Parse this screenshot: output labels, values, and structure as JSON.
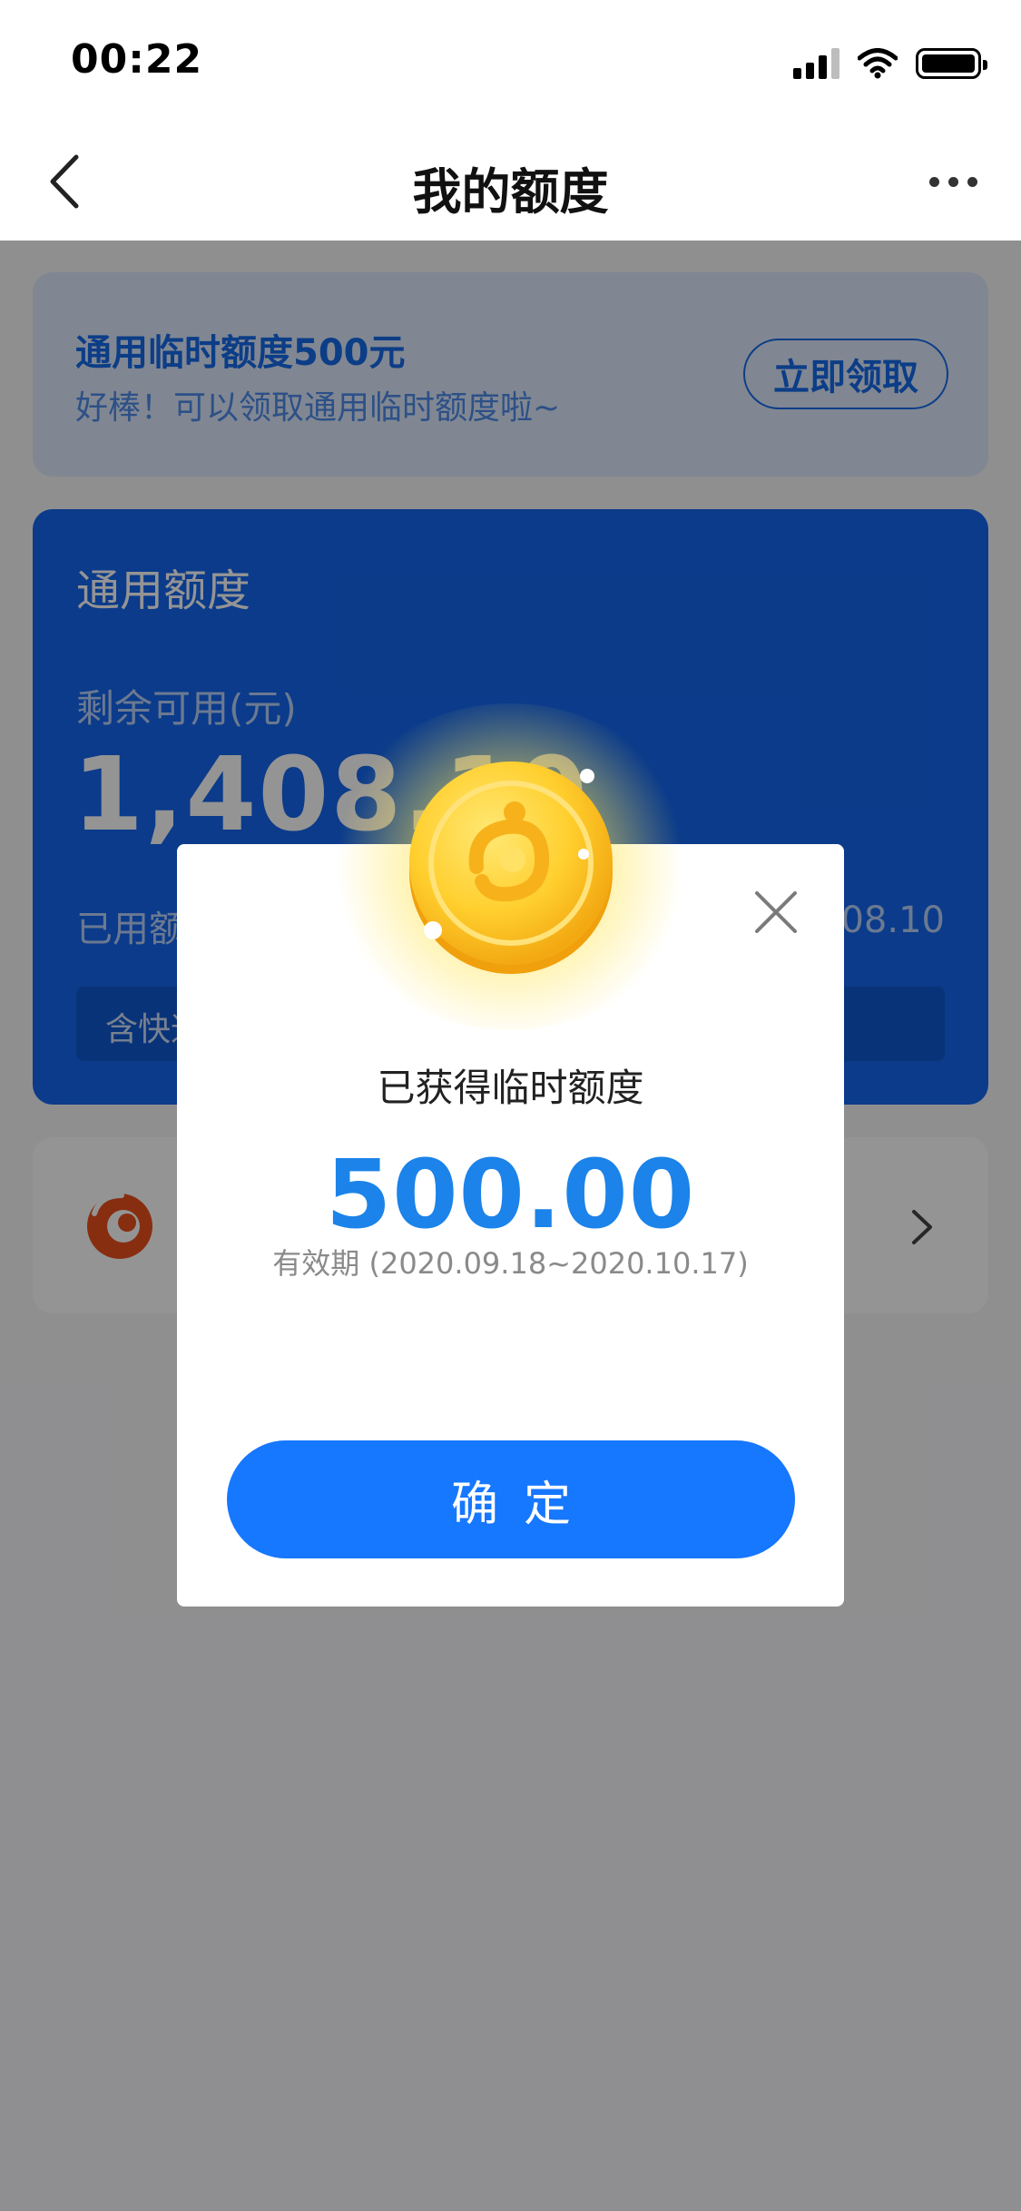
{
  "status_bar": {
    "time": "00:22",
    "icons": [
      "signal-icon",
      "wifi-icon",
      "battery-icon"
    ]
  },
  "nav": {
    "title": "我的额度",
    "back_icon": "chevron-left-icon",
    "more_icon": "more-dots-icon"
  },
  "promo": {
    "title": "通用临时额度500元",
    "subtitle": "好棒！可以领取通用临时额度啦~",
    "button_label": "立即领取"
  },
  "credit": {
    "title": "通用额度",
    "remaining_label": "剩余可用(元)",
    "remaining_value": "1,408.10",
    "used_label": "已用额度",
    "total_value_partial": "408.10",
    "note": "含快速还款"
  },
  "service_row": {
    "logo_icon": "brand-logo-icon",
    "chevron_icon": "chevron-right-icon"
  },
  "dialog": {
    "heading": "已获得临时额度",
    "amount": "500.00",
    "validity": "有效期 (2020.09.18~2020.10.17)",
    "confirm_label": "确定",
    "close_icon": "close-icon",
    "coin_icon": "gold-coin-icon"
  },
  "colors": {
    "primary_blue": "#1677ff",
    "amount_blue": "#1b83e9",
    "card_blue": "#1466ee",
    "coin_gold": "#ffc425"
  }
}
